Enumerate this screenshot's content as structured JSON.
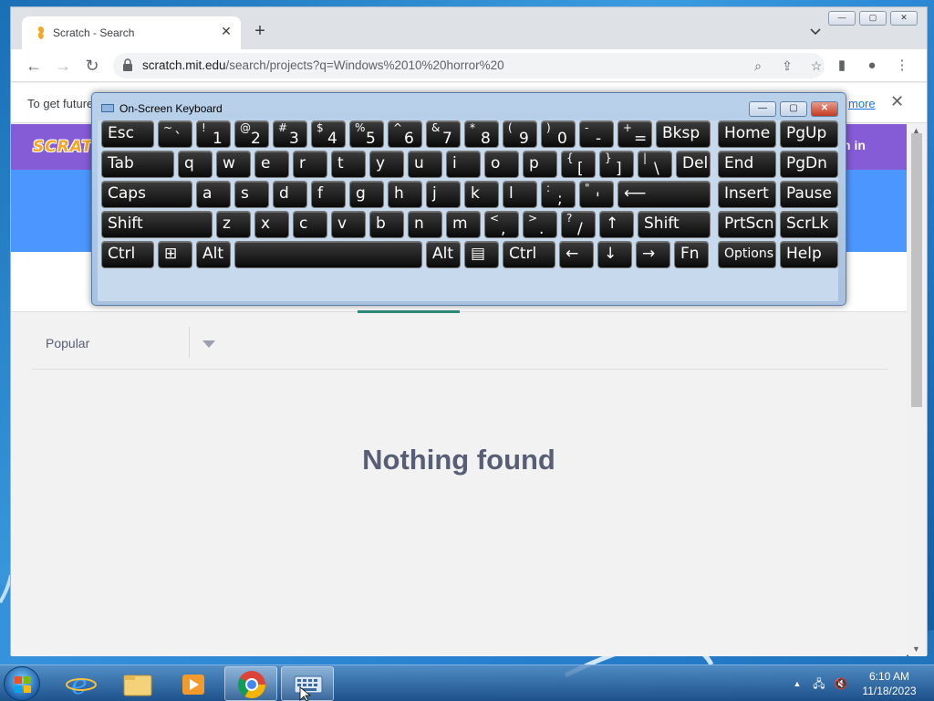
{
  "browser": {
    "tab_title": "Scratch - Search",
    "url_host": "scratch.mit.edu",
    "url_path": "/search/projects?q=Windows%2010%20horror%20",
    "window_buttons": [
      "—",
      "▢",
      "✕"
    ]
  },
  "infobar": {
    "text": "To get future",
    "link": "more"
  },
  "scratch": {
    "logo": "SCRATCH",
    "sign_in": "n in",
    "sort_label": "Popular",
    "empty_message": "Nothing found"
  },
  "osk": {
    "title": "On-Screen Keyboard",
    "keys": [
      {
        "label": "Esc"
      },
      {
        "top": "~",
        "main": "`"
      },
      {
        "top": "!",
        "main": "1"
      },
      {
        "top": "@",
        "main": "2"
      },
      {
        "top": "#",
        "main": "3"
      },
      {
        "top": "$",
        "main": "4"
      },
      {
        "top": "%",
        "main": "5"
      },
      {
        "top": "^",
        "main": "6"
      },
      {
        "top": "&",
        "main": "7"
      },
      {
        "top": "*",
        "main": "8"
      },
      {
        "top": "(",
        "main": "9"
      },
      {
        "top": ")",
        "main": "0"
      },
      {
        "top": "-",
        "main": "-"
      },
      {
        "top": "+",
        "main": "="
      },
      {
        "label": "Bksp"
      },
      {
        "label": "Home"
      },
      {
        "label": "PgUp"
      },
      {
        "label": "Tab"
      },
      {
        "label": "q"
      },
      {
        "label": "w"
      },
      {
        "label": "e"
      },
      {
        "label": "r"
      },
      {
        "label": "t"
      },
      {
        "label": "y"
      },
      {
        "label": "u"
      },
      {
        "label": "i"
      },
      {
        "label": "o"
      },
      {
        "label": "p"
      },
      {
        "top": "{",
        "main": "["
      },
      {
        "top": "}",
        "main": "]"
      },
      {
        "top": "|",
        "main": "\\"
      },
      {
        "label": "Del"
      },
      {
        "label": "End"
      },
      {
        "label": "PgDn"
      },
      {
        "label": "Caps"
      },
      {
        "label": "a"
      },
      {
        "label": "s"
      },
      {
        "label": "d"
      },
      {
        "label": "f"
      },
      {
        "label": "g"
      },
      {
        "label": "h"
      },
      {
        "label": "j"
      },
      {
        "label": "k"
      },
      {
        "label": "l"
      },
      {
        "top": ":",
        "main": ";"
      },
      {
        "top": "\"",
        "main": "'"
      },
      {
        "label": "⟵"
      },
      {
        "label": "Insert"
      },
      {
        "label": "Pause"
      },
      {
        "label": "Shift"
      },
      {
        "label": "z"
      },
      {
        "label": "x"
      },
      {
        "label": "c"
      },
      {
        "label": "v"
      },
      {
        "label": "b"
      },
      {
        "label": "n"
      },
      {
        "label": "m"
      },
      {
        "top": "<",
        "main": ","
      },
      {
        "top": ">",
        "main": "."
      },
      {
        "top": "?",
        "main": "/"
      },
      {
        "label": "↑"
      },
      {
        "label": "Shift"
      },
      {
        "label": "PrtScn"
      },
      {
        "label": "ScrLk"
      },
      {
        "label": "Ctrl"
      },
      {
        "label": "⊞"
      },
      {
        "label": "Alt"
      },
      {
        "label": ""
      },
      {
        "label": "Alt"
      },
      {
        "label": "▤"
      },
      {
        "label": "Ctrl"
      },
      {
        "label": "←"
      },
      {
        "label": "↓"
      },
      {
        "label": "→"
      },
      {
        "label": "Fn"
      },
      {
        "label": "Options"
      },
      {
        "label": "Help"
      }
    ]
  },
  "taskbar": {
    "time": "6:10 AM",
    "date": "11/18/2023"
  },
  "colors": {
    "scratch_purple": "#855cd6",
    "scratch_blue": "#4c97ff",
    "tab_underline": "#2e8b7a",
    "desktop": "#1a6fb5"
  }
}
